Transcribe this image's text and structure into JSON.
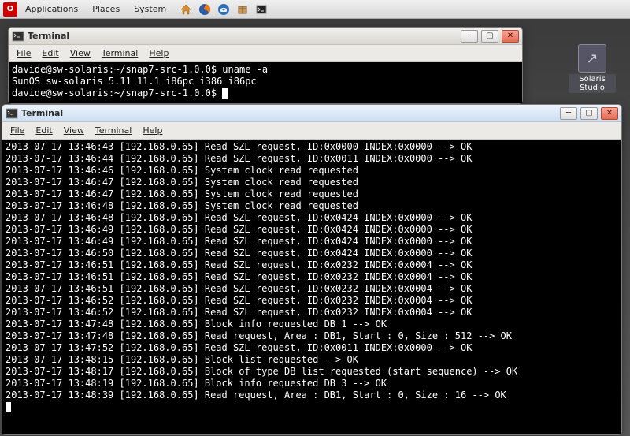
{
  "panel": {
    "menus": [
      "Applications",
      "Places",
      "System"
    ]
  },
  "desktop_icon": {
    "label": "Solaris Studio"
  },
  "window1": {
    "title": "Terminal",
    "menus": [
      "File",
      "Edit",
      "View",
      "Terminal",
      "Help"
    ],
    "lines": [
      "davide@sw-solaris:~/snap7-src-1.0.0$ uname -a",
      "SunOS sw-solaris 5.11 11.1 i86pc i386 i86pc",
      "davide@sw-solaris:~/snap7-src-1.0.0$ "
    ]
  },
  "window2": {
    "title": "Terminal",
    "menus": [
      "File",
      "Edit",
      "View",
      "Terminal",
      "Help"
    ],
    "lines": [
      "2013-07-17 13:46:43 [192.168.0.65] Read SZL request, ID:0x0000 INDEX:0x0000 --> OK",
      "2013-07-17 13:46:44 [192.168.0.65] Read SZL request, ID:0x0011 INDEX:0x0000 --> OK",
      "2013-07-17 13:46:46 [192.168.0.65] System clock read requested",
      "2013-07-17 13:46:47 [192.168.0.65] System clock read requested",
      "2013-07-17 13:46:47 [192.168.0.65] System clock read requested",
      "2013-07-17 13:46:48 [192.168.0.65] System clock read requested",
      "2013-07-17 13:46:48 [192.168.0.65] Read SZL request, ID:0x0424 INDEX:0x0000 --> OK",
      "2013-07-17 13:46:49 [192.168.0.65] Read SZL request, ID:0x0424 INDEX:0x0000 --> OK",
      "2013-07-17 13:46:49 [192.168.0.65] Read SZL request, ID:0x0424 INDEX:0x0000 --> OK",
      "2013-07-17 13:46:50 [192.168.0.65] Read SZL request, ID:0x0424 INDEX:0x0000 --> OK",
      "2013-07-17 13:46:51 [192.168.0.65] Read SZL request, ID:0x0232 INDEX:0x0004 --> OK",
      "2013-07-17 13:46:51 [192.168.0.65] Read SZL request, ID:0x0232 INDEX:0x0004 --> OK",
      "2013-07-17 13:46:51 [192.168.0.65] Read SZL request, ID:0x0232 INDEX:0x0004 --> OK",
      "2013-07-17 13:46:52 [192.168.0.65] Read SZL request, ID:0x0232 INDEX:0x0004 --> OK",
      "2013-07-17 13:46:52 [192.168.0.65] Read SZL request, ID:0x0232 INDEX:0x0004 --> OK",
      "2013-07-17 13:47:48 [192.168.0.65] Block info requested DB 1 --> OK",
      "2013-07-17 13:47:48 [192.168.0.65] Read request, Area : DB1, Start : 0, Size : 512 --> OK",
      "2013-07-17 13:47:52 [192.168.0.65] Read SZL request, ID:0x0011 INDEX:0x0000 --> OK",
      "2013-07-17 13:48:15 [192.168.0.65] Block list requested --> OK",
      "2013-07-17 13:48:17 [192.168.0.65] Block of type DB list requested (start sequence) --> OK",
      "2013-07-17 13:48:19 [192.168.0.65] Block info requested DB 3 --> OK",
      "2013-07-17 13:48:39 [192.168.0.65] Read request, Area : DB1, Start : 0, Size : 16 --> OK"
    ]
  }
}
